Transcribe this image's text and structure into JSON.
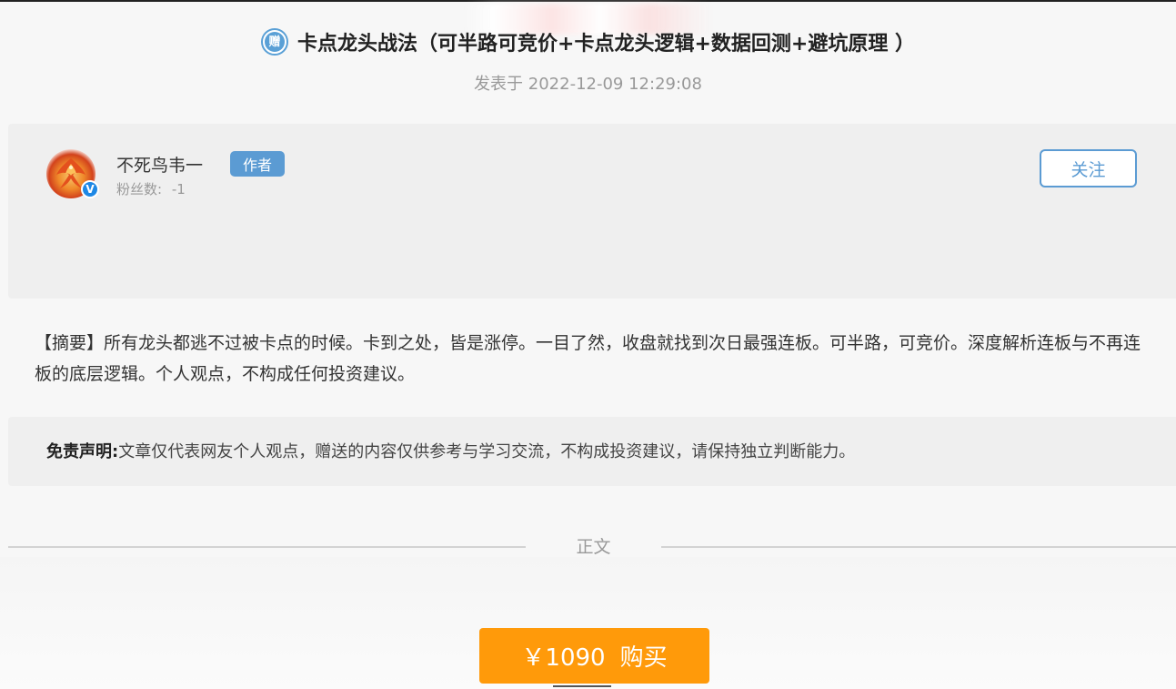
{
  "article": {
    "title": "卡点龙头战法（可半路可竞价+卡点龙头逻辑+数据回测+避坑原理 ）",
    "gift_icon_char": "赠",
    "published": "发表于 2022-12-09 12:29:08"
  },
  "author": {
    "name": "不死鸟韦一",
    "badge": "作者",
    "fans_label": "粉丝数:",
    "fans_count": "-1",
    "follow_label": "关注",
    "verified_char": "V"
  },
  "abstract": {
    "text": "【摘要】所有龙头都逃不过被卡点的时候。卡到之处，皆是涨停。一目了然，收盘就找到次日最强连板。可半路，可竞价。深度解析连板与不再连板的底层逻辑。个人观点，不构成任何投资建议。"
  },
  "disclaimer": {
    "label": "免责声明:",
    "text": "文章仅代表网友个人观点，赠送的内容仅供参考与学习交流，不构成投资建议，请保持独立判断能力。"
  },
  "divider": {
    "label": "正文"
  },
  "purchase": {
    "price": "￥1090",
    "label": "购买"
  },
  "colors": {
    "accent_blue": "#5b9bd3",
    "buy_orange": "#ff9a0a",
    "verified_blue": "#1e88e5"
  }
}
